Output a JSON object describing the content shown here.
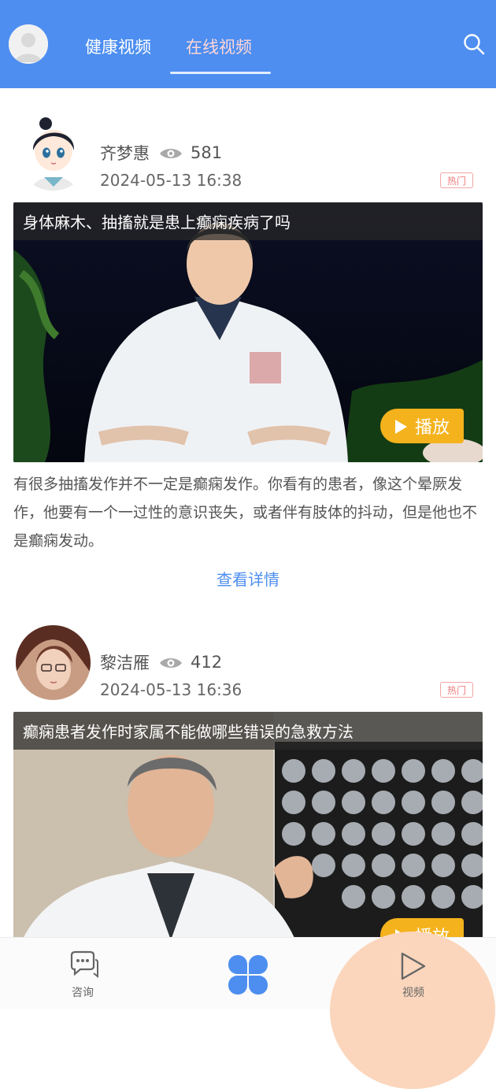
{
  "header": {
    "tabs": [
      {
        "label": "健康视频"
      },
      {
        "label": "在线视频"
      }
    ],
    "active_tab": 1,
    "search_icon": "search-icon",
    "accent_color": "#4d8ef0"
  },
  "cards": [
    {
      "author": "齐梦惠",
      "views": "581",
      "date": "2024-05-13 16:38",
      "badge": "热门",
      "video_title": "身体麻木、抽搐就是患上癫痫疾病了吗",
      "play_label": "播放",
      "summary": "有很多抽搐发作并不一定是癫痫发作。你看有的患者，像这个晕厥发作，他要有一个一过性的意识丧失，或者伴有肢体的抖动，但是他也不是癫痫发动。",
      "detail_link": "查看详情"
    },
    {
      "author": "黎洁雁",
      "views": "412",
      "date": "2024-05-13 16:36",
      "badge": "热门",
      "video_title": "癫痫患者发作时家属不能做哪些错误的急救方法",
      "play_label": "播放"
    }
  ],
  "bottom_nav": {
    "items": [
      {
        "label": "咨询",
        "icon": "chat-icon"
      },
      {
        "label": "",
        "icon": "clover-icon"
      },
      {
        "label": "视频",
        "icon": "play-outline-icon"
      }
    ],
    "active": 2,
    "highlight_color": "#fbd6bc"
  }
}
